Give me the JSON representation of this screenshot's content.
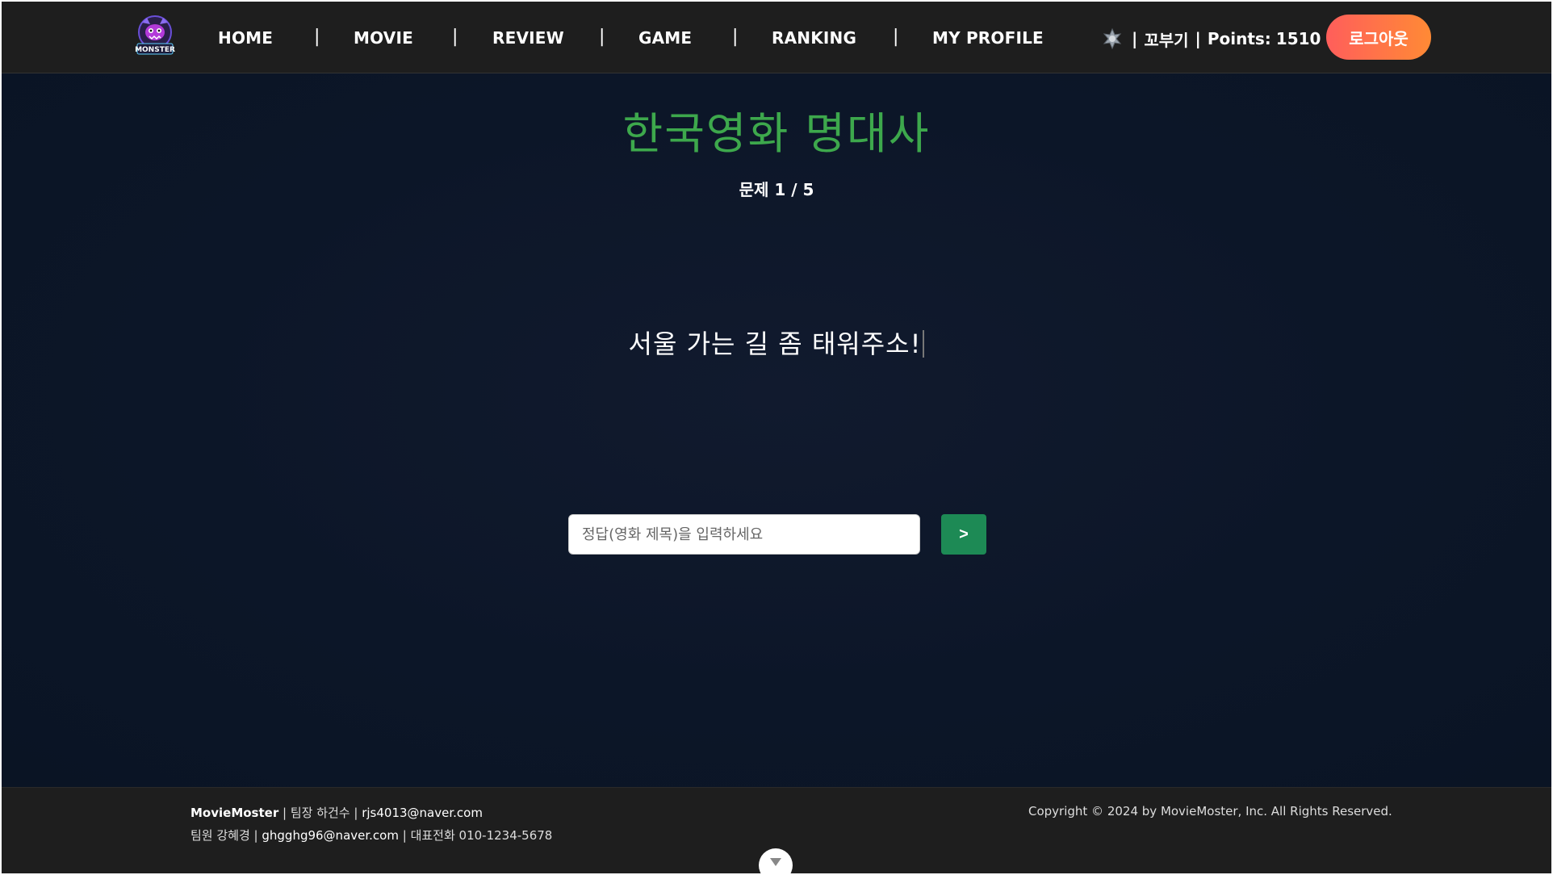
{
  "nav": {
    "logo_text": "MONSTER",
    "items": [
      {
        "label": "HOME"
      },
      {
        "label": "MOVIE"
      },
      {
        "label": "REVIEW"
      },
      {
        "label": "GAME"
      },
      {
        "label": "RANKING"
      },
      {
        "label": "MY PROFILE"
      }
    ],
    "separator": "|",
    "user": {
      "rank_icon": "rank-badge-icon",
      "prefix": "|",
      "nickname": "꼬부기",
      "divider": "|",
      "points_label": "Points:",
      "points_value": "1510"
    },
    "logout_label": "로그아웃"
  },
  "game": {
    "title": "한국영화 명대사",
    "progress_label": "문제",
    "progress": "1 / 5",
    "quote": "서울 가는 길 좀 태워주소!",
    "input": {
      "placeholder": "정답(영화 제목)을 입력하세요",
      "value": ""
    },
    "submit_label": ">"
  },
  "footer": {
    "brand": "MovieMoster",
    "leader_label": "| 팀장 하건수 |",
    "leader_email": "rjs4013@naver.com",
    "member_label": "팀원 강혜경 |",
    "member_email": "ghgghg96@naver.com",
    "phone_label": "| 대표전화 010-1234-5678",
    "copyright": "Copyright © 2024 by MovieMoster, Inc. All Rights Reserved.",
    "scroll_icon": "chevron-down-icon"
  },
  "colors": {
    "navbar_bg": "#1e1e1e",
    "main_bg": "#0c1628",
    "title_green": "#3da84c",
    "submit_green": "#1d8a55",
    "logout_gradient_start": "#ff5e5b",
    "logout_gradient_end": "#ff8a35"
  }
}
